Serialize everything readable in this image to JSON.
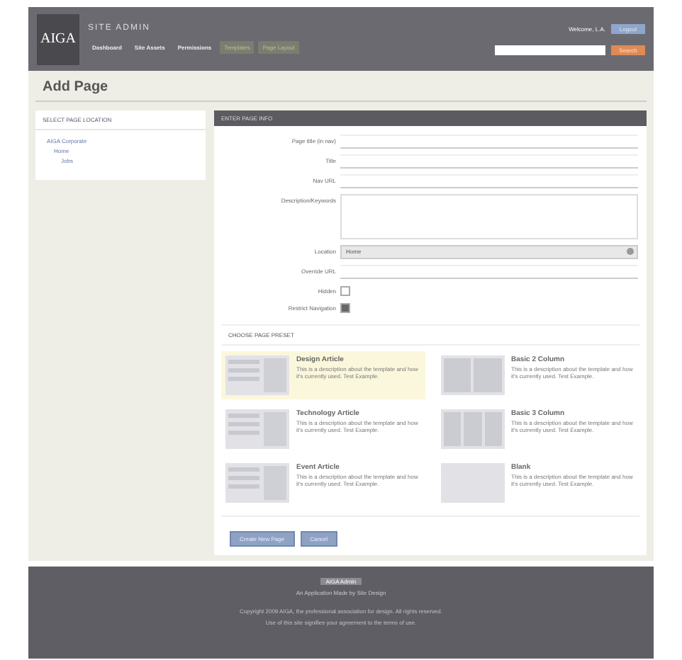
{
  "header": {
    "logo": "AIGA",
    "title": "SITE ADMIN",
    "nav": [
      {
        "label": "Dashboard",
        "selected": false
      },
      {
        "label": "Site Assets",
        "selected": false
      },
      {
        "label": "Permissions",
        "selected": false
      },
      {
        "label": "Templates",
        "selected": true
      },
      {
        "label": "Page Layout",
        "selected": true
      }
    ],
    "welcome": "Welcome, L.A.",
    "logout": "Logout",
    "search_button": "Search"
  },
  "page_title": "Add Page",
  "location_panel": {
    "title": "SELECT PAGE LOCATION",
    "tree": [
      {
        "label": "AIGA Corporate",
        "children": [
          {
            "label": "Home",
            "children": [
              {
                "label": "Jobs"
              }
            ]
          }
        ]
      }
    ]
  },
  "form": {
    "title": "ENTER PAGE INFO",
    "fields": [
      {
        "kind": "text",
        "label": "Page title (in nav)"
      },
      {
        "kind": "text",
        "label": "Title"
      },
      {
        "kind": "text",
        "label": "Nav URL"
      },
      {
        "kind": "textarea",
        "label": "Description/Keywords"
      },
      {
        "kind": "select",
        "label": "Location",
        "value": "Home"
      },
      {
        "kind": "text",
        "label": "Override URL"
      },
      {
        "kind": "checkbox",
        "label": "Hidden",
        "checked": false
      },
      {
        "kind": "checkbox",
        "label": "Restrict Navigation",
        "checked": true
      }
    ]
  },
  "presets": {
    "title": "CHOOSE PAGE PRESET",
    "items": [
      {
        "name": "Design Article",
        "description": "This is a description about the template and how it's currently used. Test Example.",
        "kind": "article",
        "selected": true
      },
      {
        "name": "Basic 2 Column",
        "description": "This is a description about the template and how it's currently used. Test Example.",
        "kind": "two",
        "selected": false
      },
      {
        "name": "Technology Article",
        "description": "This is a description about the template and how it's currently used. Test Example.",
        "kind": "article",
        "selected": false
      },
      {
        "name": "Basic 3 Column",
        "description": "This is a description about the template and how it's currently used. Test Example.",
        "kind": "three",
        "selected": false
      },
      {
        "name": "Event Article",
        "description": "This is a description about the template and how it's currently used. Test Example.",
        "kind": "article",
        "selected": false
      },
      {
        "name": "Blank",
        "description": "This is a description about the template and how it's currently used. Test Example.",
        "kind": "blank",
        "selected": false
      }
    ]
  },
  "buttons": [
    "Create New Page",
    "Cancel"
  ],
  "footer": {
    "title": "AIGA Admin",
    "tagline": "An Application Made by Site Design",
    "lines": [
      "Copyright 2009 AIGA, the professional association for design. All rights reserved.",
      "Use of this site signifies your agreement to the terms of use."
    ]
  }
}
